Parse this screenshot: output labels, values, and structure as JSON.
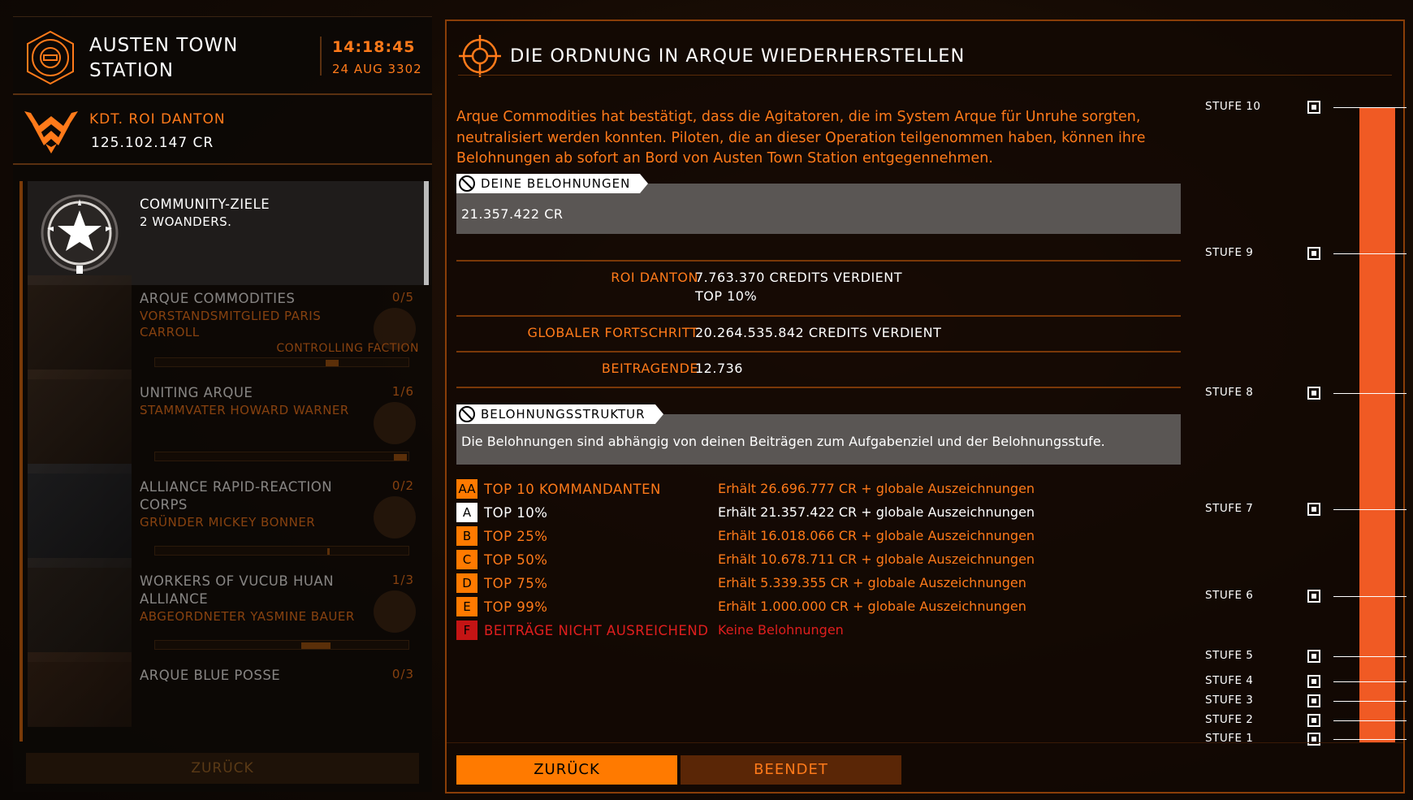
{
  "station": {
    "name_line1": "AUSTEN TOWN",
    "name_line2": "STATION",
    "time": "14:18:45",
    "date": "24 AUG 3302"
  },
  "commander": {
    "name": "KDT. ROI DANTON",
    "credits": "125.102.147 CR"
  },
  "list": {
    "header": {
      "title": "COMMUNITY-ZIELE",
      "subtitle": "2 WOANDERS."
    },
    "items": [
      {
        "title": "ARQUE COMMODITIES",
        "count": "0/5",
        "sub": "VORSTANDSMITGLIED PARIS CARROLL",
        "faction": "CONTROLLING FACTION",
        "progress": 0.08
      },
      {
        "title": "UNITING ARQUE",
        "count": "1/6",
        "sub": "STAMMVATER HOWARD WARNER",
        "faction": "",
        "progress": 0.06
      },
      {
        "title": "ALLIANCE RAPID-REACTION CORPS",
        "count": "0/2",
        "sub": "GRÜNDER MICKEY BONNER",
        "faction": "",
        "progress": 0.02
      },
      {
        "title": "WORKERS OF VUCUB HUAN ALLIANCE",
        "count": "1/3",
        "sub": "ABGEORDNETER YASMINE BAUER",
        "faction": "",
        "progress": 0.12
      },
      {
        "title": "ARQUE BLUE POSSE",
        "count": "0/3",
        "sub": "",
        "faction": "",
        "progress": 0
      }
    ],
    "back_label": "ZURÜCK"
  },
  "mission": {
    "title": "DIE ORDNUNG IN ARQUE WIEDERHERSTELLEN",
    "description": "Arque Commodities hat bestätigt, dass die Agitatoren, die im System Arque für Unruhe sorgten, neutralisiert werden konnten. Piloten, die an dieser Operation teilgenommen haben, können ihre Belohnungen ab sofort an Bord von Austen Town Station entgegennehmen.",
    "rewards_label": "DEINE BELOHNUNGEN",
    "reward_amount": "21.357.422 CR",
    "stats": [
      {
        "label": "ROI DANTON",
        "value_line1": "7.763.370 CREDITS VERDIENT",
        "value_line2": "TOP 10%"
      },
      {
        "label": "GLOBALER FORTSCHRITT",
        "value_line1": "20.264.535.842 CREDITS VERDIENT",
        "value_line2": ""
      },
      {
        "label": "BEITRAGENDE",
        "value_line1": "12.736",
        "value_line2": ""
      }
    ],
    "structure_label": "BELOHNUNGSSTRUKTUR",
    "structure_text": "Die Belohnungen sind abhängig von deinen Beiträgen zum Aufgabenziel und der Belohnungsstufe.",
    "tiers": [
      {
        "letter": "AA",
        "name": "TOP 10 KOMMANDANTEN",
        "reward": "Erhält 26.696.777 CR + globale Auszeichnungen"
      },
      {
        "letter": "A",
        "name": "TOP 10%",
        "reward": "Erhält 21.357.422 CR + globale Auszeichnungen"
      },
      {
        "letter": "B",
        "name": "TOP 25%",
        "reward": "Erhält 16.018.066 CR + globale Auszeichnungen"
      },
      {
        "letter": "C",
        "name": "TOP 50%",
        "reward": "Erhält 10.678.711 CR + globale Auszeichnungen"
      },
      {
        "letter": "D",
        "name": "TOP 75%",
        "reward": "Erhält 5.339.355 CR + globale Auszeichnungen"
      },
      {
        "letter": "E",
        "name": "TOP 99%",
        "reward": "Erhält 1.000.000 CR + globale Auszeichnungen"
      },
      {
        "letter": "F",
        "name": "BEITRÄGE NICHT AUSREICHEND",
        "reward": "Keine Belohnungen"
      }
    ],
    "levels": [
      "STUFE 10",
      "STUFE 9",
      "STUFE 8",
      "STUFE 7",
      "STUFE 6",
      "STUFE 5",
      "STUFE 4",
      "STUFE 3",
      "STUFE 2",
      "STUFE 1"
    ],
    "progress_fraction": 1.0,
    "buttons": {
      "back": "ZURÜCK",
      "finished": "BEENDET"
    }
  },
  "colors": {
    "accent": "#ff7a1a",
    "tier_orange": "#ff7a00",
    "tier_white": "#ffffff",
    "tier_red": "#c41414",
    "progress": "#f05a24"
  }
}
